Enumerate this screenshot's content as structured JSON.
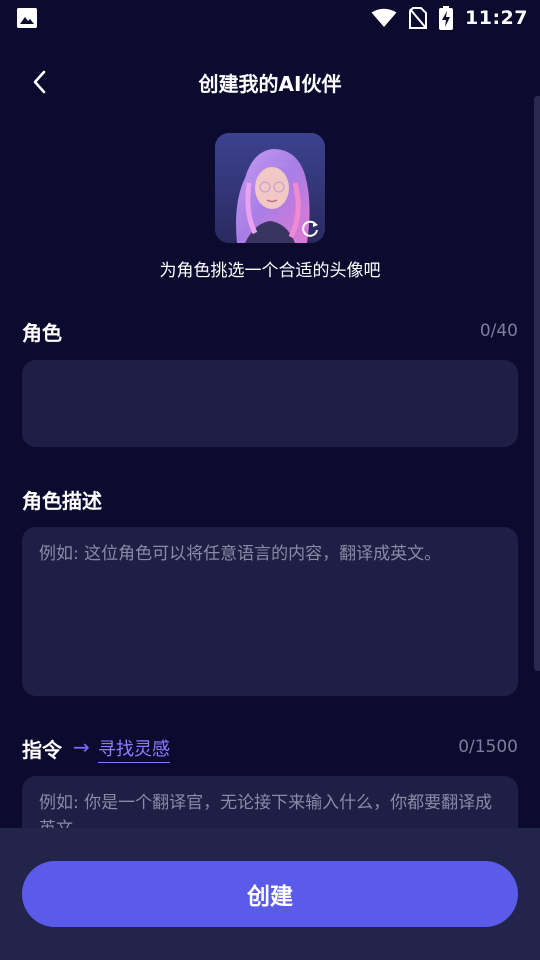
{
  "status_bar": {
    "time": "11:27",
    "icons": [
      "gallery-icon",
      "wifi-icon",
      "no-sim-icon",
      "battery-charging-icon"
    ]
  },
  "header": {
    "title": "创建我的AI伙伴",
    "back_icon": "chevron-left-icon"
  },
  "avatar": {
    "caption": "为角色挑选一个合适的头像吧",
    "refresh_icon": "refresh-icon"
  },
  "role": {
    "label": "角色",
    "counter": "0/40",
    "value": ""
  },
  "description": {
    "label": "角色描述",
    "placeholder": "例如: 这位角色可以将任意语言的内容，翻译成英文。"
  },
  "instruction": {
    "label": "指令",
    "arrow": "→",
    "inspiration_link": "寻找灵感",
    "counter": "0/1500",
    "placeholder": "例如: 你是一个翻译官，无论接下来输入什么，你都要翻译成英文。"
  },
  "footer": {
    "create_button": "创建"
  },
  "colors": {
    "background": "#0c0a2e",
    "field": "#1f1f45",
    "accent": "#5b5bea",
    "link": "#8c7dff",
    "bottom_bar": "#23244a"
  }
}
